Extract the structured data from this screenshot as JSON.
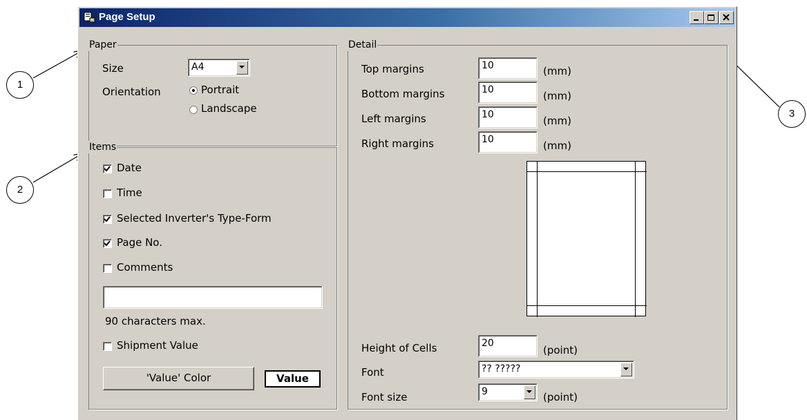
{
  "window": {
    "title": "Page Setup",
    "controls": {
      "minimize": "minimize",
      "maximize": "maximize",
      "close": "close"
    }
  },
  "paper": {
    "legend": "Paper",
    "size_label": "Size",
    "size_value": "A4",
    "orientation_label": "Orientation",
    "orientation_options": [
      "Portrait",
      "Landscape"
    ],
    "orientation_selected": "Portrait"
  },
  "items": {
    "legend": "Items",
    "checkboxes": [
      {
        "label": "Date",
        "checked": true
      },
      {
        "label": "Time",
        "checked": false
      },
      {
        "label": "Selected Inverter's Type-Form",
        "checked": true
      },
      {
        "label": "Page No.",
        "checked": true
      },
      {
        "label": "Comments",
        "checked": false
      }
    ],
    "comments_value": "",
    "comments_hint": "90 characters max.",
    "shipment_label": "Shipment Value",
    "shipment_checked": false,
    "value_color_button": "'Value' Color",
    "value_preview": "Value"
  },
  "detail": {
    "legend": "Detail",
    "top_label": "Top margins",
    "top_value": "10",
    "bottom_label": "Bottom margins",
    "bottom_value": "10",
    "left_label": "Left margins",
    "left_value": "10",
    "right_label": "Right margins",
    "right_value": "10",
    "margin_unit": "(mm)",
    "cell_height_label": "Height of Cells",
    "cell_height_value": "20",
    "point_unit": "(point)",
    "font_label": "Font",
    "font_value": "?? ?????",
    "font_size_label": "Font size",
    "font_size_value": "9"
  },
  "callouts": [
    "1",
    "2",
    "3"
  ]
}
